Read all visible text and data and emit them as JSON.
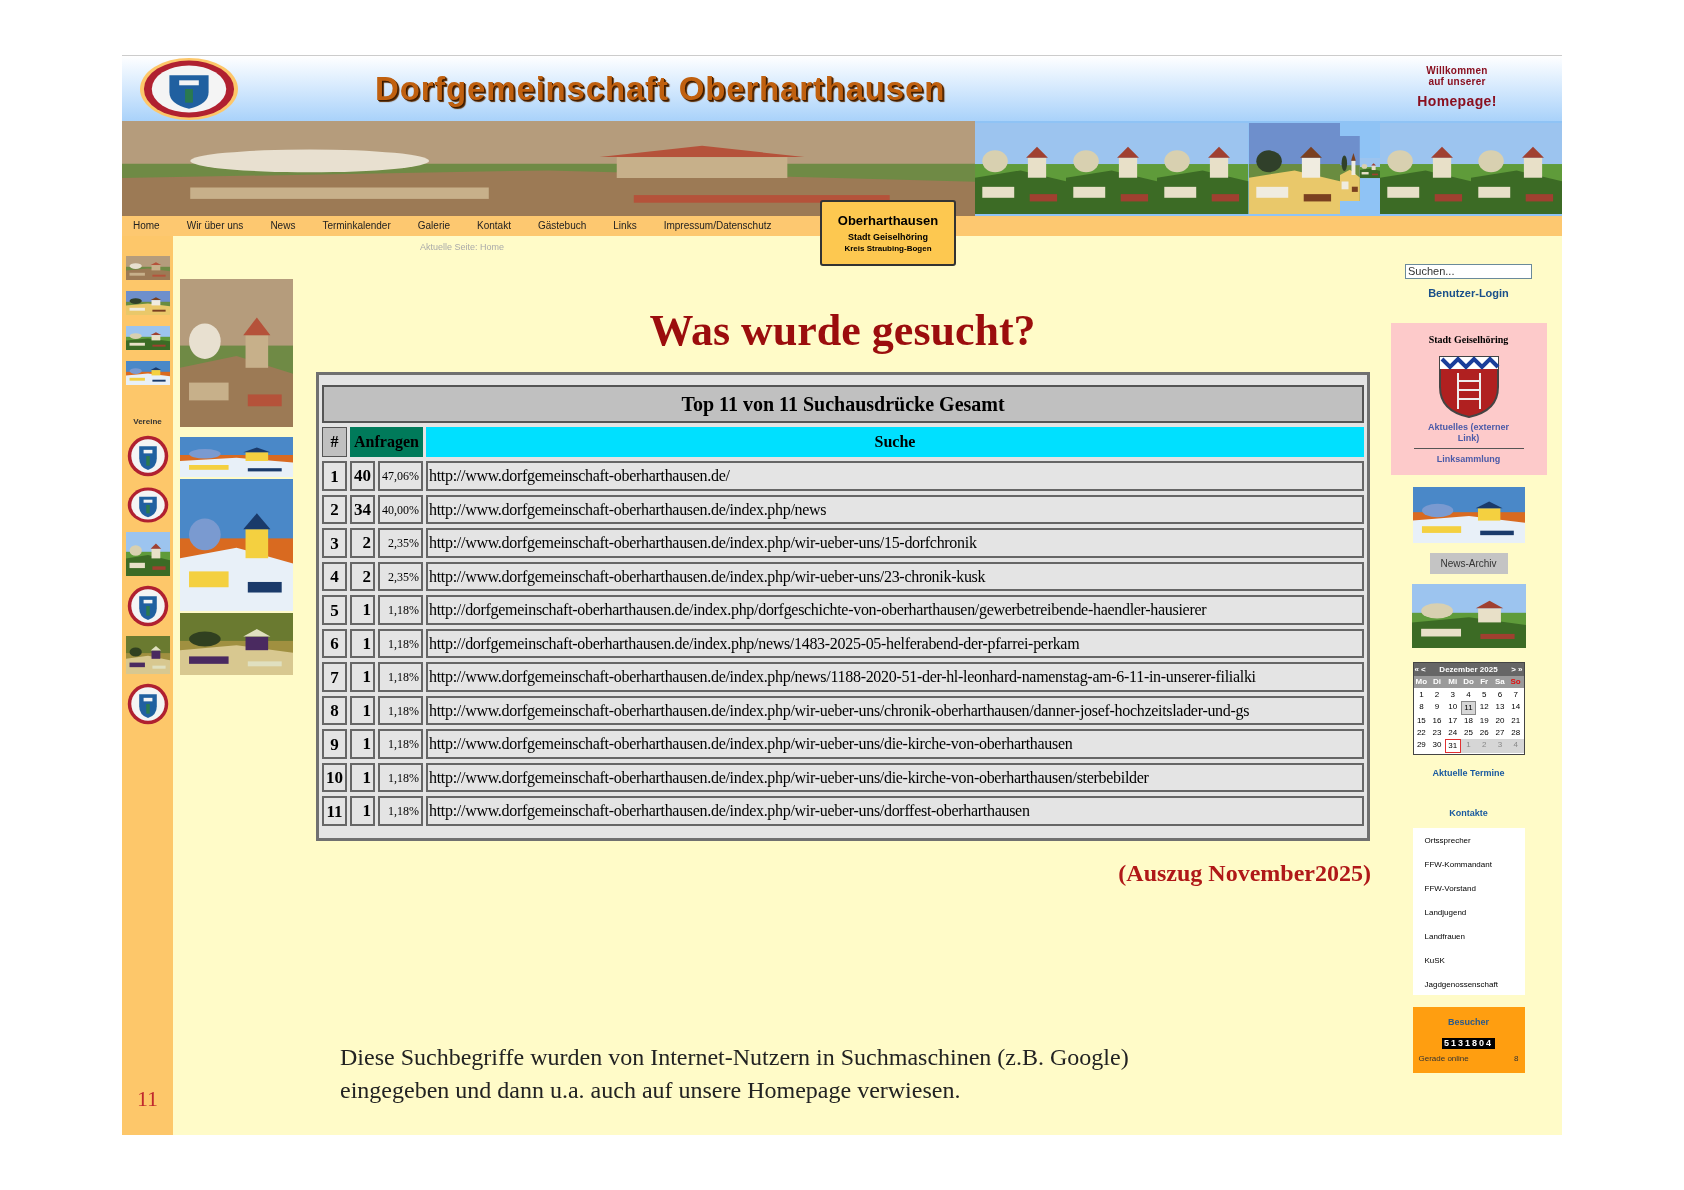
{
  "header": {
    "title": "Dorfgemeinschaft Oberharthausen",
    "welcome": "Willkommen auf unserer",
    "welcome_emphasis": "Homepage!"
  },
  "nav": {
    "items": [
      "Home",
      "Wir über uns",
      "News",
      "Terminkalender",
      "Galerie",
      "Kontakt",
      "Gästebuch",
      "Links",
      "Impressum/Datenschutz"
    ]
  },
  "current_page": "Aktuelle Seite: Home",
  "place_sign": {
    "name": "Oberharthausen",
    "town": "Stadt Geiselhöring",
    "district": "Kreis Straubing-Bogen"
  },
  "left_column": {
    "section_label": "Vereine",
    "page_number": "11"
  },
  "main": {
    "heading": "Was wurde gesucht?",
    "table": {
      "title": "Top 11 von 11 Suchausdrücke Gesamt",
      "columns": [
        "#",
        "Anfragen",
        "Suche"
      ],
      "rows": [
        {
          "rank": "1",
          "count": "40",
          "share": "47,06%",
          "url": "http://www.dorfgemeinschaft-oberharthausen.de/"
        },
        {
          "rank": "2",
          "count": "34",
          "share": "40,00%",
          "url": "http://www.dorfgemeinschaft-oberharthausen.de/index.php/news"
        },
        {
          "rank": "3",
          "count": "2",
          "share": "2,35%",
          "url": "http://www.dorfgemeinschaft-oberharthausen.de/index.php/wir-ueber-uns/15-dorfchronik"
        },
        {
          "rank": "4",
          "count": "2",
          "share": "2,35%",
          "url": "http://www.dorfgemeinschaft-oberharthausen.de/index.php/wir-ueber-uns/23-chronik-kusk"
        },
        {
          "rank": "5",
          "count": "1",
          "share": "1,18%",
          "url": "http://dorfgemeinschaft-oberharthausen.de/index.php/dorfgeschichte-von-oberharthausen/gewerbetreibende-haendler-hausierer"
        },
        {
          "rank": "6",
          "count": "1",
          "share": "1,18%",
          "url": "http://dorfgemeinschaft-oberharthausen.de/index.php/news/1483-2025-05-helferabend-der-pfarrei-perkam"
        },
        {
          "rank": "7",
          "count": "1",
          "share": "1,18%",
          "url": "http://www.dorfgemeinschaft-oberharthausen.de/index.php/news/1188-2020-51-der-hl-leonhard-namenstag-am-6-11-in-unserer-filialki"
        },
        {
          "rank": "8",
          "count": "1",
          "share": "1,18%",
          "url": "http://www.dorfgemeinschaft-oberharthausen.de/index.php/wir-ueber-uns/chronik-oberharthausen/danner-josef-hochzeitslader-und-gs"
        },
        {
          "rank": "9",
          "count": "1",
          "share": "1,18%",
          "url": "http://www.dorfgemeinschaft-oberharthausen.de/index.php/wir-ueber-uns/die-kirche-von-oberharthausen"
        },
        {
          "rank": "10",
          "count": "1",
          "share": "1,18%",
          "url": "http://www.dorfgemeinschaft-oberharthausen.de/index.php/wir-ueber-uns/die-kirche-von-oberharthausen/sterbebilder"
        },
        {
          "rank": "11",
          "count": "1",
          "share": "1,18%",
          "url": "http://www.dorfgemeinschaft-oberharthausen.de/index.php/wir-ueber-uns/dorffest-oberharthausen"
        }
      ]
    },
    "note": "(Auszug November2025)",
    "description": "Diese Suchbegriffe wurden von Internet-Nutzern in Suchmaschinen (z.B. Google) eingegeben und dann u.a. auch auf unsere Homepage verwiesen."
  },
  "sidebar": {
    "search": {
      "placeholder": "Suchen..."
    },
    "login": "Benutzer-Login",
    "city_box": {
      "title": "Stadt Geiselhöring",
      "link": "Aktuelles (externer Link)",
      "links": "Linksammlung"
    },
    "archive_button": "News-Archiv",
    "calendar": {
      "prev": [
        "«",
        "<"
      ],
      "month": "Dezember 2025",
      "next": [
        ">",
        "»"
      ],
      "weekdays": [
        {
          "label": "Mo",
          "kind": "weekday"
        },
        {
          "label": "Di",
          "kind": "weekday"
        },
        {
          "label": "Mi",
          "kind": "weekday"
        },
        {
          "label": "Do",
          "kind": "weekday"
        },
        {
          "label": "Fr",
          "kind": "weekday"
        },
        {
          "label": "Sa",
          "kind": "weekday"
        },
        {
          "label": "So",
          "kind": "sunday"
        }
      ],
      "days": [
        {
          "label": "1",
          "kind": "day"
        },
        {
          "label": "2",
          "kind": "day"
        },
        {
          "label": "3",
          "kind": "day"
        },
        {
          "label": "4",
          "kind": "day"
        },
        {
          "label": "5",
          "kind": "day"
        },
        {
          "label": "6",
          "kind": "day"
        },
        {
          "label": "7",
          "kind": "day"
        },
        {
          "label": "8",
          "kind": "day"
        },
        {
          "label": "9",
          "kind": "day"
        },
        {
          "label": "10",
          "kind": "day"
        },
        {
          "label": "11",
          "kind": "highlighted"
        },
        {
          "label": "12",
          "kind": "day"
        },
        {
          "label": "13",
          "kind": "day"
        },
        {
          "label": "14",
          "kind": "day"
        },
        {
          "label": "15",
          "kind": "day"
        },
        {
          "label": "16",
          "kind": "day"
        },
        {
          "label": "17",
          "kind": "day"
        },
        {
          "label": "18",
          "kind": "day"
        },
        {
          "label": "19",
          "kind": "day"
        },
        {
          "label": "20",
          "kind": "day"
        },
        {
          "label": "21",
          "kind": "day"
        },
        {
          "label": "22",
          "kind": "day"
        },
        {
          "label": "23",
          "kind": "day"
        },
        {
          "label": "24",
          "kind": "day"
        },
        {
          "label": "25",
          "kind": "day"
        },
        {
          "label": "26",
          "kind": "day"
        },
        {
          "label": "27",
          "kind": "day"
        },
        {
          "label": "28",
          "kind": "day"
        },
        {
          "label": "29",
          "kind": "day"
        },
        {
          "label": "30",
          "kind": "day"
        },
        {
          "label": "31",
          "kind": "today"
        },
        {
          "label": "1",
          "kind": "outside"
        },
        {
          "label": "2",
          "kind": "outside"
        },
        {
          "label": "3",
          "kind": "outside"
        },
        {
          "label": "4",
          "kind": "outside"
        }
      ]
    },
    "events_link": "Aktuelle Termine",
    "contacts": {
      "title": "Kontakte",
      "items": [
        "Ortssprecher",
        "FFW-Kommandant",
        "FFW-Vorstand",
        "Landjugend",
        "Landfrauen",
        "KuSK",
        "Jagdgenossenschaft"
      ]
    },
    "visitors": {
      "title": "Besucher",
      "count": "5131804",
      "online_label": "Gerade online",
      "online_count": "8"
    }
  }
}
